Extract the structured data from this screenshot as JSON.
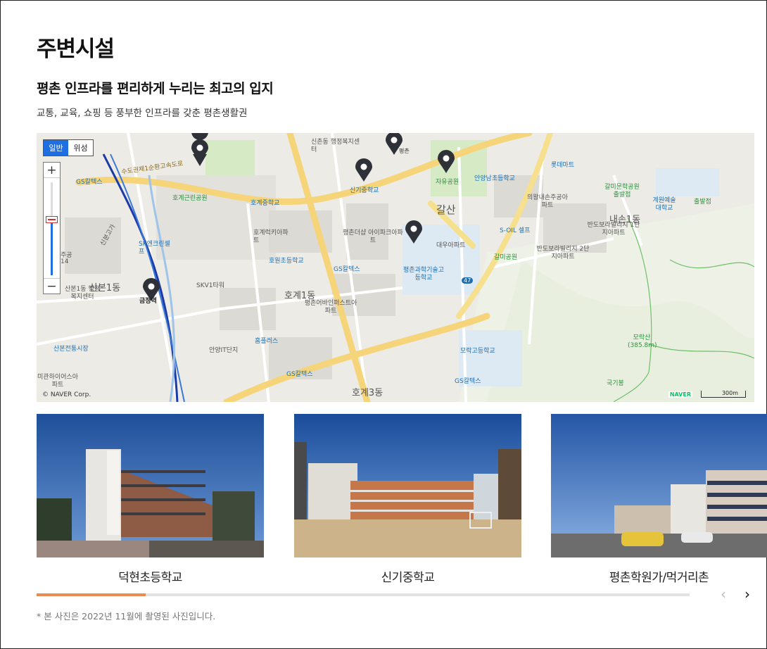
{
  "section_title": "주변시설",
  "headline": "평촌 인프라를 편리하게 누리는 최고의 입지",
  "description": "교통, 교육, 쇼핑 등 풍부한 인프라를 갖춘 평촌생활권",
  "map": {
    "type_buttons": {
      "normal": "일반",
      "satellite": "위성"
    },
    "zoom_in": "+",
    "zoom_out": "−",
    "copyright": "© NAVER Corp.",
    "brand": "NAVER",
    "scale": "300m",
    "labels": {
      "l1": "평촌",
      "l2": "신기중학교",
      "l3": "자유공원",
      "l4": "호계근린공원",
      "l5": "호계중학교",
      "l6": "안양남초등학교",
      "l7": "롯데마트",
      "l8": "신촌동 행정복지센터",
      "l9": "수도권제1순환고속도로",
      "l10": "GS칼텍스",
      "l11": "신분고가",
      "l12": "SK엔크린셀프",
      "l13": "호계럭키아파트",
      "l14": "평촌더샵 아이파크아파트",
      "l15": "호원초등학교",
      "l16": "GS칼텍스",
      "l17": "평촌과학기술고등학교",
      "l18": "갈산",
      "l19": "대우아파트",
      "l20": "S-OIL 셀프",
      "l21": "갈미공원",
      "l22": "의왕내손주공아파트",
      "l23": "반도보라빌리지 1단지아파트",
      "l24": "반도보라빌리지 2단지아파트",
      "l25": "갈미문학공원 출발점",
      "l26": "계원예술대학교",
      "l27": "출발점",
      "l28": "내손1동",
      "l29": "산본1동",
      "l30": "산본1동 행정복지센터",
      "l31": "금정역",
      "l32": "SKV1타워",
      "l33": "호계1동",
      "l34": "평촌어바인퍼스트아파트",
      "l35": "홈플러스",
      "l36": "안양IT단지",
      "l37": "산본전통시장",
      "l38": "미관하이어스아파트",
      "l39": "GS칼텍스",
      "l40": "호계3동",
      "l41": "GS칼텍스",
      "l42": "모락고등학교",
      "l43": "모락산 (385.8m)",
      "l44": "국기봉",
      "l45": "47",
      "l46": "주공",
      "l47": "14"
    }
  },
  "gallery": [
    {
      "caption": "덕현초등학교"
    },
    {
      "caption": "신기중학교"
    },
    {
      "caption": "평촌학원가/먹거리촌"
    }
  ],
  "slider": {
    "progress": 0.167,
    "prev": "‹",
    "next": "›"
  },
  "footnote": "* 본 사진은 2022년 11월에 촬영된 사진입니다."
}
